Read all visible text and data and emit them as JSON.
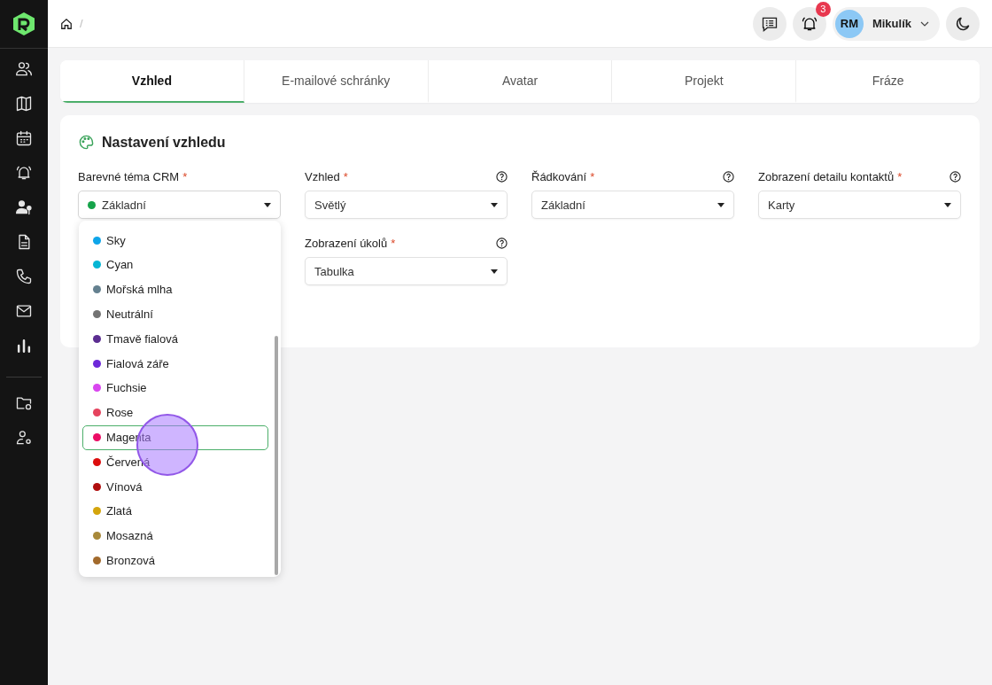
{
  "breadcrumb": {
    "separator": "/"
  },
  "topbar": {
    "notification_count": "3",
    "user": {
      "initials": "RM",
      "name": "Mikulík"
    }
  },
  "tabs": [
    {
      "label": "Vzhled",
      "selected": true
    },
    {
      "label": "E-mailové schránky",
      "selected": false
    },
    {
      "label": "Avatar",
      "selected": false
    },
    {
      "label": "Projekt",
      "selected": false
    },
    {
      "label": "Fráze",
      "selected": false
    }
  ],
  "card": {
    "title": "Nastavení vzhledu",
    "fields": [
      {
        "label": "Barevné téma CRM",
        "required": "*",
        "help": false,
        "value": "Základní",
        "color": "#16a34a",
        "open": true
      },
      {
        "label": "Vzhled",
        "required": "*",
        "help": true,
        "value": "Světlý",
        "open": false
      },
      {
        "label": "Řádkování",
        "required": "*",
        "help": true,
        "value": "Základní",
        "open": false
      },
      {
        "label": "Zobrazení detailu kontaktů",
        "required": "*",
        "help": true,
        "value": "Karty",
        "open": false
      },
      {
        "label": "Zobrazení úkolů",
        "required": "*",
        "help": true,
        "value": "Tabulka",
        "open": false
      }
    ]
  },
  "dropdown": {
    "options": [
      {
        "label": "Sky",
        "color": "#0ea5e9",
        "highlighted": false
      },
      {
        "label": "Cyan",
        "color": "#06b6d4",
        "highlighted": false
      },
      {
        "label": "Mořská mlha",
        "color": "#64808f",
        "highlighted": false
      },
      {
        "label": "Neutrální",
        "color": "#737373",
        "highlighted": false
      },
      {
        "label": "Tmavě fialová",
        "color": "#5b2d91",
        "highlighted": false
      },
      {
        "label": "Fialová záře",
        "color": "#6d28d9",
        "highlighted": false
      },
      {
        "label": "Fuchsie",
        "color": "#d946ef",
        "highlighted": false
      },
      {
        "label": "Rose",
        "color": "#e5435e",
        "highlighted": false
      },
      {
        "label": "Magenta",
        "color": "#ec0c65",
        "highlighted": true
      },
      {
        "label": "Červená",
        "color": "#dc0d0d",
        "highlighted": false
      },
      {
        "label": "Vínová",
        "color": "#b00e0e",
        "highlighted": false
      },
      {
        "label": "Zlatá",
        "color": "#d4a50c",
        "highlighted": false
      },
      {
        "label": "Mosazná",
        "color": "#a8893a",
        "highlighted": false
      },
      {
        "label": "Bronzová",
        "color": "#a26a2c",
        "highlighted": false
      }
    ]
  }
}
